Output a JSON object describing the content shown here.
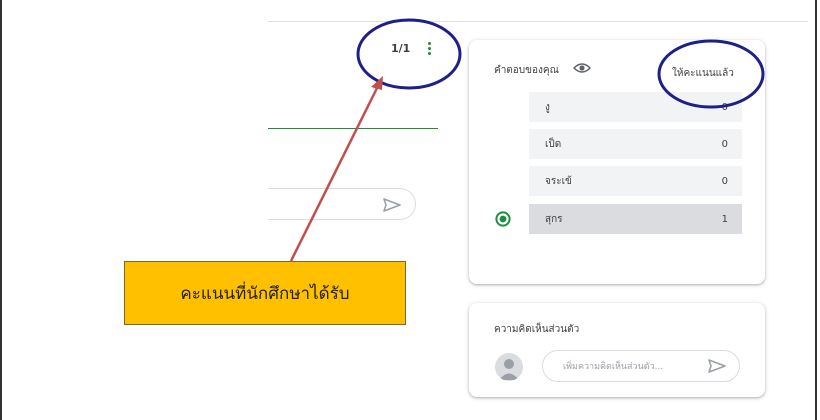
{
  "header": {
    "score": "1/1"
  },
  "reply_box": {},
  "callout": {
    "text": "คะแนนที่นักศึกษาได้รับ"
  },
  "answers_card": {
    "title": "คำตอบของคุณ",
    "status": "ให้คะแนนแล้ว",
    "options": [
      {
        "label": "งู",
        "count": "0",
        "selected": false
      },
      {
        "label": "เป็ด",
        "count": "0",
        "selected": false
      },
      {
        "label": "จระเข้",
        "count": "0",
        "selected": false
      },
      {
        "label": "สุกร",
        "count": "1",
        "selected": true
      }
    ]
  },
  "comment_card": {
    "title": "ความคิดเห็นส่วนตัว",
    "placeholder": "เพิ่มความคิดเห็นส่วนตัว..."
  },
  "colors": {
    "accent_green": "#1e8e3e",
    "annotation_navy": "#1f1f8a",
    "annotation_arrow": "#c0504d",
    "callout_fill": "#ffc000"
  }
}
